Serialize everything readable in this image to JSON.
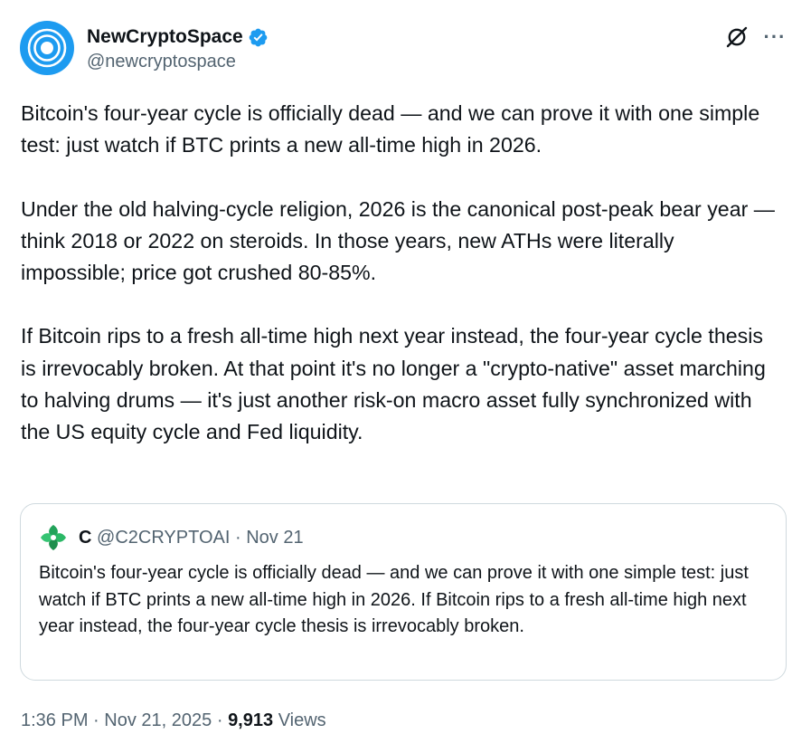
{
  "author": {
    "name": "NewCryptoSpace",
    "handle": "@newcryptospace",
    "avatar_icon": "target-icon",
    "verified_icon": "verified-badge-icon",
    "accent_color": "#1d9bf0"
  },
  "actions": {
    "grok_icon": "grok-icon",
    "more_label": "···"
  },
  "tweet": {
    "paragraphs": [
      "Bitcoin's four-year cycle is officially dead — and we can prove it with one simple test: just watch if BTC prints a new all-time high in 2026.",
      "Under the old halving-cycle religion, 2026 is the canonical post-peak bear year — think 2018 or 2022 on steroids. In those years, new ATHs were literally impossible; price got crushed 80-85%.",
      "If Bitcoin rips to a fresh all-time high next year instead, the four-year cycle thesis is irrevocably broken. At that point it's no longer a \"crypto-native\" asset marching to halving drums — it's just another risk-on macro asset fully synchronized with the US equity cycle and Fed liquidity."
    ]
  },
  "quote": {
    "name": "C",
    "handle": "@C2CRYPTOAI",
    "separator": "·",
    "date": "Nov 21",
    "avatar_icon": "leaf-avatar-icon",
    "text": "Bitcoin's four-year cycle is officially dead — and we can prove it with one simple test: just watch if BTC prints a new all-time high in 2026. If Bitcoin rips to a fresh all-time high next year instead, the four-year cycle thesis is irrevocably broken."
  },
  "meta": {
    "time": "1:36 PM",
    "separator1": "·",
    "date": "Nov 21, 2025",
    "separator2": "·",
    "views_count": "9,913",
    "views_label": "Views"
  }
}
